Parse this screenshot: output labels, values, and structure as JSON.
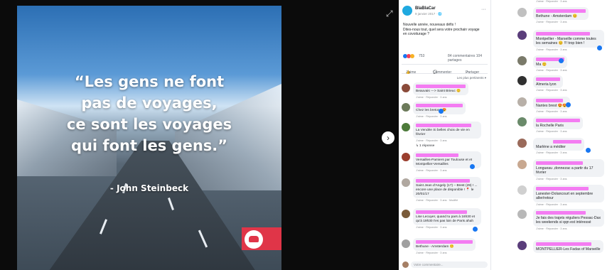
{
  "media": {
    "quote": "“Les gens ne font pas de voyages, ce sont les voyages qui font les gens.”",
    "quote_lines": [
      "“Les gens ne font",
      "pas de voyages,",
      "ce sont les voyages",
      "qui font les gens.”"
    ],
    "author": "- John Steinbeck",
    "expand_glyph": "⤢",
    "next_glyph": "›"
  },
  "post": {
    "page_name": "BlaBlaCar",
    "date": "9 janvier 2017 · ",
    "more_glyph": "···",
    "text_lines": [
      "Nouvelle année, nouveaux défis !",
      "Dites-nous tout, quel sera votre prochain voyage",
      "en covoiturage ?"
    ],
    "reactions_count": "753",
    "comments_count": "84 commentaires  104 partages",
    "like_label": "J'aime",
    "comment_label": "Commenter",
    "share_label": "Partager",
    "sort_label": "Les plus pertinents ▾",
    "reply_label": "↳ 1 réponse",
    "composer_placeholder": "Votre commentaire..."
  },
  "colors": {
    "reaction_like": "#1877f2",
    "reaction_love": "#f33e58",
    "reaction_haha": "#f7b125",
    "redaction": "#f47cf2"
  },
  "comments_left": [
    {
      "text": "Beauvais ---> Saint Brieuc 😊",
      "meta": "J'aime · Répondre · 3 ans"
    },
    {
      "text": "Chez les bretons 😍",
      "meta": "J'aime · Répondre · 3 ans"
    },
    {
      "text": "La Vendée Si belles choix de vie en février",
      "meta": "J'aime · Répondre · 3 ans"
    },
    {
      "text": "Versailles-Pamiers par Toulouse et et Montpellier-Versailles",
      "meta": "J'aime · Répondre · 3 ans"
    },
    {
      "text": "Saint Jean d'Angely (17) – Brest (29) ! ... encore une place de disponible ! 📍 le 20/01/17",
      "meta": "J'aime · Répondre · 3 ans · Modifié"
    },
    {
      "text": "Lise Lecuyer, quand tu pars à 16h30 et qu'à 19h30 t'es pas loin de Paris ahah",
      "meta": "J'aime · Répondre · 3 ans"
    },
    {
      "text": "Bethune - Amsterdam 😊",
      "meta": "J'aime · Répondre · 3 ans"
    }
  ],
  "comments_right": [
    {
      "text": "",
      "meta": "J'aime · Répondre · 3 ans"
    },
    {
      "text": "Bethune - Amsterdam 😊",
      "meta": "J'aime · Répondre · 3 ans"
    },
    {
      "text": "Montpellier - Marseille comme toutes les semaines 😊 !!! trop bien !",
      "meta": "J'aime · Répondre · 3 ans"
    },
    {
      "text": "Ma 😊",
      "meta": "J'aime · Répondre · 3 ans"
    },
    {
      "text": "Almeria lyon",
      "meta": "J'aime · Répondre · 3 ans"
    },
    {
      "text": "Nantes brest 😍😍",
      "meta": "J'aime · Répondre · 3 ans"
    },
    {
      "text": "la Rochelle Paris",
      "meta": "J'aime · Répondre · 3 ans"
    },
    {
      "text": "Marlène                    a méditer",
      "meta": "J'aime · Répondre · 3 ans"
    },
    {
      "text": "Longueau ,donnezac a partir du 17 février",
      "meta": "J'aime · Répondre · 3 ans"
    },
    {
      "text": "Lanester-Dolancourt en septembre aller/retour",
      "meta": "J'aime · Répondre · 3 ans"
    },
    {
      "text": "Je fais des trajets réguliers Pessac-Dax les weekends si qqn est intéressé",
      "meta": "J'aime · Répondre · 3 ans"
    },
    {
      "text": "MONTPELLIER-Les Fadas of Marseille",
      "meta": ""
    }
  ]
}
